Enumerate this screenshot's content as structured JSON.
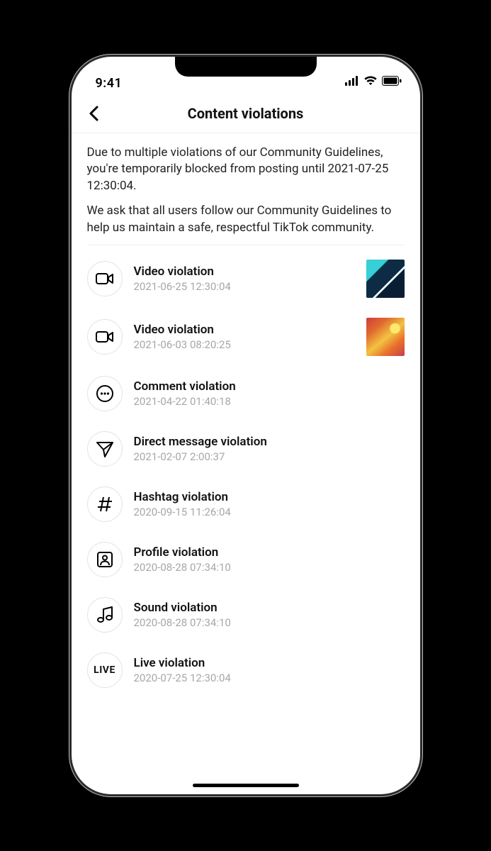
{
  "status": {
    "time": "9:41"
  },
  "nav": {
    "title": "Content violations"
  },
  "intro": {
    "p1": "Due to multiple violations of our Community Guidelines, you're temporarily blocked from posting until 2021-07-25 12:30:04.",
    "p2": "We ask that all users follow our Community Guidelines to help us maintain a safe, respectful TikTok community."
  },
  "violations": [
    {
      "icon": "video",
      "title": "Video violation",
      "time": "2021-06-25 12:30:04",
      "thumb": "thumb-1"
    },
    {
      "icon": "video",
      "title": "Video violation",
      "time": "2021-06-03 08:20:25",
      "thumb": "thumb-2"
    },
    {
      "icon": "comment",
      "title": "Comment violation",
      "time": "2021-04-22 01:40:18"
    },
    {
      "icon": "send",
      "title": "Direct message violation",
      "time": "2021-02-07 2:00:37"
    },
    {
      "icon": "hashtag",
      "title": "Hashtag violation",
      "time": "2020-09-15 11:26:04"
    },
    {
      "icon": "profile",
      "title": "Profile violation",
      "time": "2020-08-28 07:34:10"
    },
    {
      "icon": "sound",
      "title": "Sound violation",
      "time": "2020-08-28 07:34:10"
    },
    {
      "icon": "live",
      "title": "Live violation",
      "time": "2020-07-25 12:30:04"
    }
  ]
}
